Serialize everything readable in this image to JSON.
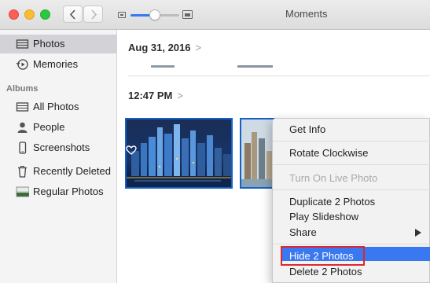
{
  "toolbar": {
    "window_title": "Moments",
    "zoom_level": 0.5
  },
  "sidebar": {
    "items": [
      {
        "label": "Photos",
        "icon": "photos-icon"
      },
      {
        "label": "Memories",
        "icon": "memories-icon"
      }
    ],
    "albums_header": "Albums",
    "albums": [
      {
        "label": "All Photos",
        "icon": "all-photos-icon"
      },
      {
        "label": "People",
        "icon": "people-icon"
      },
      {
        "label": "Screenshots",
        "icon": "screenshots-icon"
      },
      {
        "label": "Recently Deleted",
        "icon": "trash-icon"
      },
      {
        "label": "Regular Photos",
        "icon": "album-thumbnail-icon"
      }
    ]
  },
  "main": {
    "date_header": "Aug 31, 2016",
    "time_header": "12:47 PM",
    "chevron": ">"
  },
  "context_menu": {
    "get_info": "Get Info",
    "rotate": "Rotate Clockwise",
    "live_photo": "Turn On Live Photo",
    "duplicate": "Duplicate 2 Photos",
    "slideshow": "Play Slideshow",
    "share": "Share",
    "hide": "Hide 2 Photos",
    "delete": "Delete 2 Photos"
  },
  "colors": {
    "accent": "#3a78f2",
    "selection_border": "#1460c8",
    "annotation_red": "#e0262d"
  }
}
